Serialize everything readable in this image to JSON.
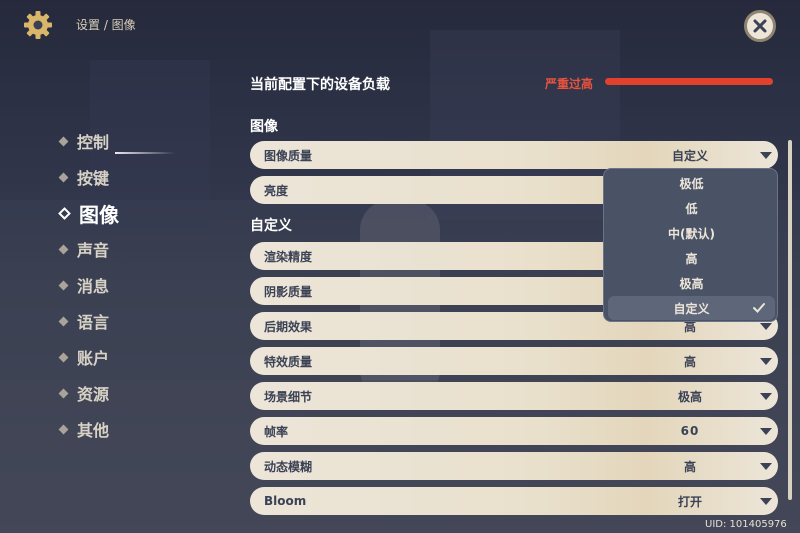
{
  "header": {
    "breadcrumb": "设置 / 图像",
    "icons": {
      "settings": "gear-icon",
      "close": "close-icon"
    }
  },
  "sidebar": {
    "items": [
      {
        "label": "控制"
      },
      {
        "label": "按键"
      },
      {
        "label": "图像",
        "active": true
      },
      {
        "label": "声音"
      },
      {
        "label": "消息"
      },
      {
        "label": "语言"
      },
      {
        "label": "账户"
      },
      {
        "label": "资源"
      },
      {
        "label": "其他"
      }
    ]
  },
  "load": {
    "title": "当前配置下的设备负载",
    "status": "严重过高",
    "status_color": "#e2412e"
  },
  "sections": {
    "image": "图像",
    "custom": "自定义"
  },
  "rows": [
    {
      "name": "图像质量",
      "value": "自定义"
    },
    {
      "name": "亮度",
      "value": ""
    },
    {
      "name": "渲染精度",
      "value": ""
    },
    {
      "name": "阴影质量",
      "value": ""
    },
    {
      "name": "后期效果",
      "value": "高"
    },
    {
      "name": "特效质量",
      "value": "高"
    },
    {
      "name": "场景细节",
      "value": "极高"
    },
    {
      "name": "帧率",
      "value": "60"
    },
    {
      "name": "动态模糊",
      "value": "高"
    },
    {
      "name": "Bloom",
      "value": "打开"
    }
  ],
  "dropdown": {
    "options": [
      "极低",
      "低",
      "中(默认)",
      "高",
      "极高",
      "自定义"
    ],
    "selected": "自定义"
  },
  "uid": "UID: 101405976",
  "colors": {
    "accent": "#ece5d8",
    "text_dark": "#3b4255",
    "danger": "#e2412e"
  }
}
